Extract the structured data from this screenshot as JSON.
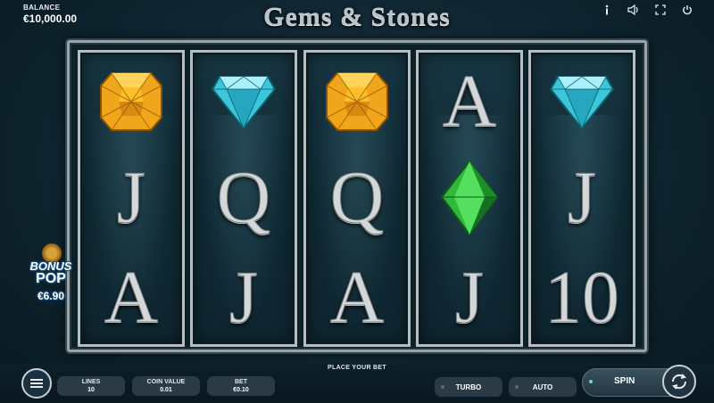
{
  "header": {
    "balance_label": "BALANCE",
    "balance_value": "€10,000.00",
    "title": "Gems & Stones",
    "icons": [
      "info-icon",
      "sound-icon",
      "fullscreen-icon",
      "power-icon"
    ]
  },
  "reels": [
    {
      "symbols": [
        "yellow-gem",
        "J",
        "A"
      ]
    },
    {
      "symbols": [
        "blue-gem",
        "Q",
        "J"
      ]
    },
    {
      "symbols": [
        "yellow-gem",
        "Q",
        "A"
      ]
    },
    {
      "symbols": [
        "A",
        "green-gem",
        "J"
      ]
    },
    {
      "symbols": [
        "blue-gem",
        "J",
        "10"
      ]
    }
  ],
  "bonus": {
    "line1": "BONUS",
    "line2": "POP",
    "amount": "€6.90"
  },
  "footer": {
    "place_bet": "PLACE YOUR BET",
    "lines": {
      "label": "LINES",
      "value": "10"
    },
    "coin_value": {
      "label": "COIN VALUE",
      "value": "0.01"
    },
    "bet": {
      "label": "BET",
      "value": "€0.10"
    },
    "turbo_label": "TURBO",
    "auto_label": "AUTO",
    "spin_label": "SPIN"
  },
  "colors": {
    "yellow_gem": "#f0a51a",
    "blue_gem": "#3cc6dc",
    "green_gem": "#2fb83a",
    "background": "#123039"
  }
}
